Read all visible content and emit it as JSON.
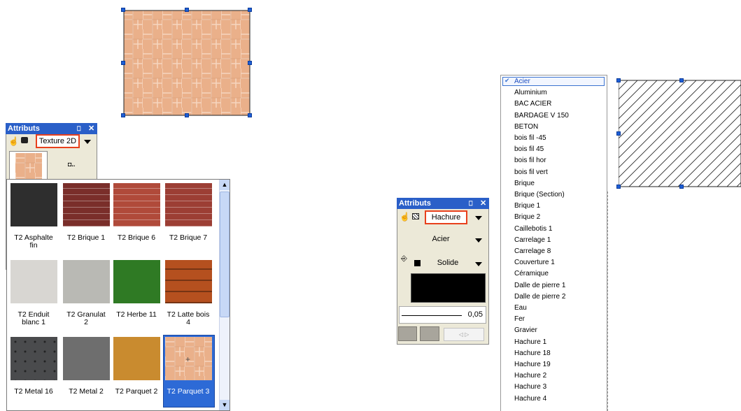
{
  "left_panel": {
    "title": "Attributs",
    "pin_glyph": "⎕",
    "close_glyph": "✕",
    "mode_value": "Texture 2D",
    "textures": [
      {
        "label": "T2 Asphalte fin",
        "color": "#2e2e2e"
      },
      {
        "label": "T2 Brique 1",
        "color": "#7a2e2a"
      },
      {
        "label": "T2 Brique 6",
        "color": "#b04a3a"
      },
      {
        "label": "T2 Brique 7",
        "color": "#9c3e34"
      },
      {
        "label": "T2 Enduit blanc 1",
        "color": "#d8d6d2"
      },
      {
        "label": "T2 Granulat 2",
        "color": "#b9b9b4"
      },
      {
        "label": "T2 Herbe 11",
        "color": "#2f7a24"
      },
      {
        "label": "T2 Latte bois 4",
        "color": "#b5501f"
      },
      {
        "label": "T2 Metal 16",
        "color": "#4a4b4d"
      },
      {
        "label": "T2 Metal 2",
        "color": "#6e6e6e"
      },
      {
        "label": "T2 Parquet 2",
        "color": "#c98b2f"
      },
      {
        "label": "T2 Parquet 3",
        "color": "#e9b28c",
        "selected": true
      }
    ]
  },
  "right_panel": {
    "title": "Attributs",
    "pin_glyph": "⎕",
    "close_glyph": "✕",
    "mode_value": "Hachure",
    "pattern_value": "Acier",
    "line_value": "Solide",
    "thickness_value": "0,05",
    "mini_icon": "◁ ▷"
  },
  "dropdown": {
    "checkmark": "✔",
    "items": [
      "Acier",
      "Aluminium",
      "BAC ACIER",
      "BARDAGE V 150",
      "BETON",
      "bois fil -45",
      "bois fil 45",
      "bois fil hor",
      "bois fil vert",
      "Brique",
      "Brique (Section)",
      "Brique 1",
      "Brique 2",
      "Caillebotis 1",
      "Carrelage 1",
      "Carrelage 8",
      "Couverture 1",
      "Céramique",
      "Dalle de pierre 1",
      "Dalle de pierre 2",
      "Eau",
      "Fer",
      "Gravier",
      "Hachure 1",
      "Hachure 18",
      "Hachure 19",
      "Hachure 2",
      "Hachure 3",
      "Hachure 4"
    ],
    "selected_index": 0
  },
  "colors": {
    "title_blue": "#2a5fc8",
    "highlight": "#e8401c",
    "parquet": "#eab08a",
    "selection_blue": "#2d6ad6"
  }
}
